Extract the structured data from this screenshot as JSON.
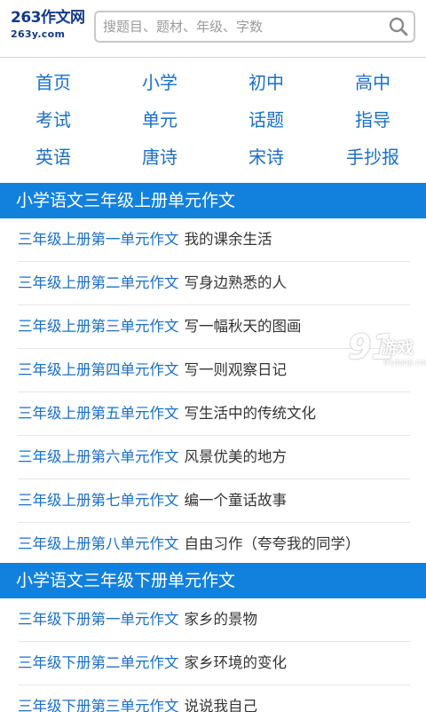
{
  "header": {
    "logo_main": "263作文网",
    "logo_domain": "263y.com",
    "search_placeholder": "搜题目、题材、年级、字数",
    "search_icon": "search-icon"
  },
  "nav": [
    {
      "label": "首页"
    },
    {
      "label": "小学"
    },
    {
      "label": "初中"
    },
    {
      "label": "高中"
    },
    {
      "label": "考试"
    },
    {
      "label": "单元"
    },
    {
      "label": "话题"
    },
    {
      "label": "指导"
    },
    {
      "label": "英语"
    },
    {
      "label": "唐诗"
    },
    {
      "label": "宋诗"
    },
    {
      "label": "手抄报"
    }
  ],
  "sections": [
    {
      "title": "小学语文三年级上册单元作文",
      "items": [
        {
          "link": "三年级上册第一单元作文",
          "title": "我的课余生活"
        },
        {
          "link": "三年级上册第二单元作文",
          "title": "写身边熟悉的人"
        },
        {
          "link": "三年级上册第三单元作文",
          "title": "写一幅秋天的图画"
        },
        {
          "link": "三年级上册第四单元作文",
          "title": "写一则观察日记"
        },
        {
          "link": "三年级上册第五单元作文",
          "title": "写生活中的传统文化"
        },
        {
          "link": "三年级上册第六单元作文",
          "title": "风景优美的地方"
        },
        {
          "link": "三年级上册第七单元作文",
          "title": "编一个童话故事"
        },
        {
          "link": "三年级上册第八单元作文",
          "title": "自由习作（夸夸我的同学）"
        }
      ]
    },
    {
      "title": "小学语文三年级下册单元作文",
      "items": [
        {
          "link": "三年级下册第一单元作文",
          "title": "家乡的景物"
        },
        {
          "link": "三年级下册第二单元作文",
          "title": "家乡环境的变化"
        },
        {
          "link": "三年级下册第三单元作文",
          "title": "说说我自己"
        }
      ]
    }
  ],
  "watermark": {
    "brand": "91",
    "name": "游戏",
    "domain": "91danji.com"
  },
  "colors": {
    "accent": "#1281dd",
    "link": "#1a6fc8",
    "text": "#333333",
    "logo": "#123a8a"
  }
}
